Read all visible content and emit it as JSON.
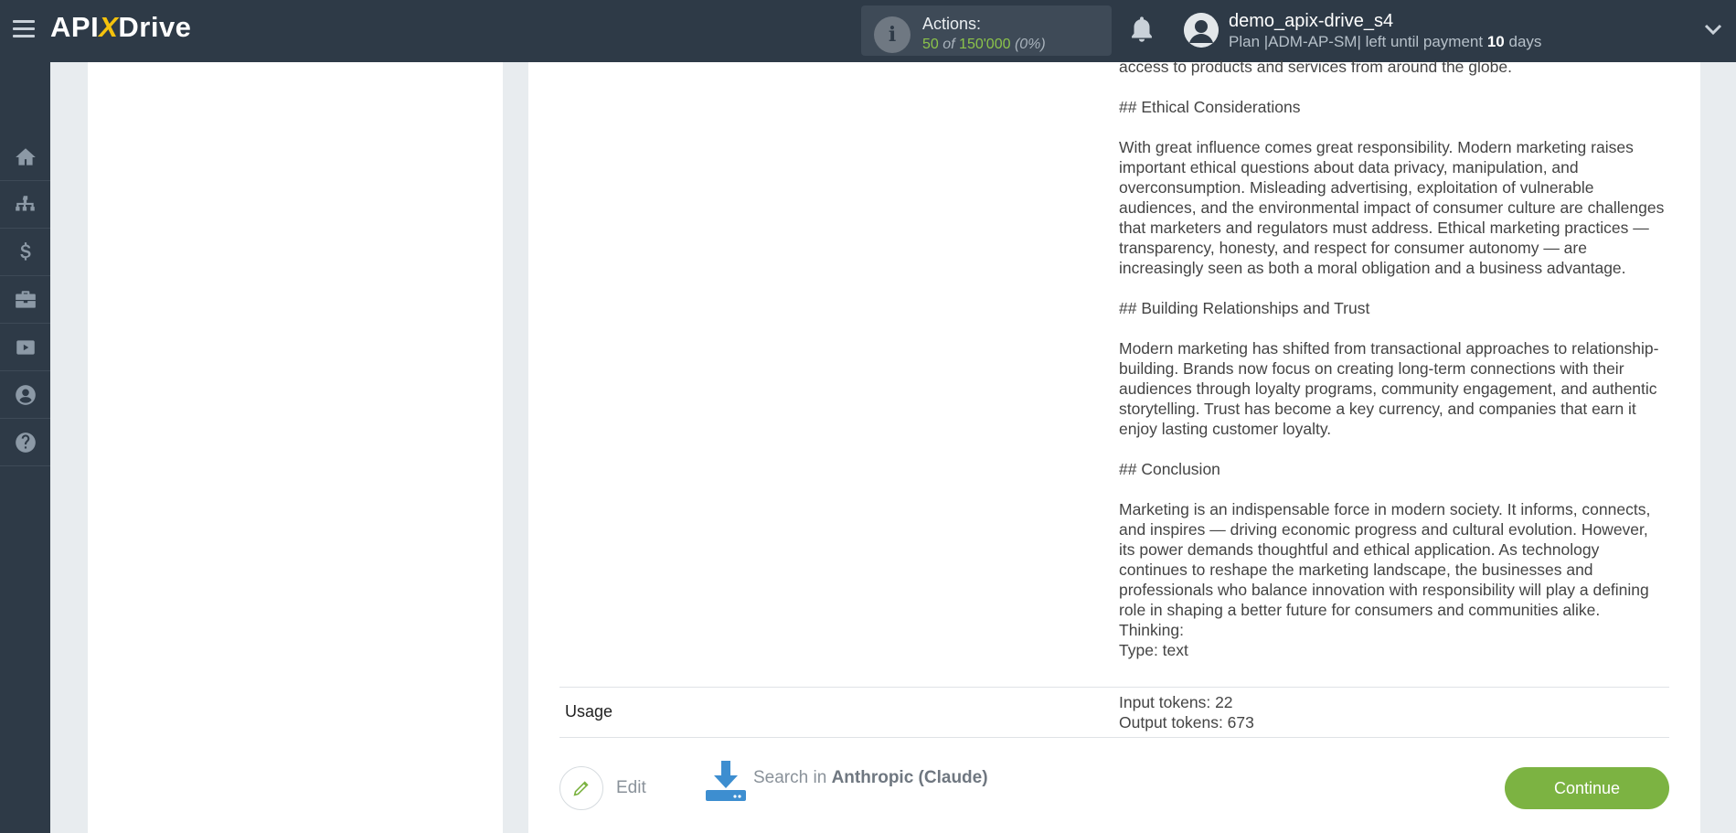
{
  "header": {
    "logo_left": "API",
    "logo_x": "X",
    "logo_right": "Drive",
    "actions_label": "Actions:",
    "actions_used": "50",
    "actions_of": "of",
    "actions_total": "150'000",
    "actions_percent": "(0%)",
    "username": "demo_apix-drive_s4",
    "plan_prefix": "Plan |ADM-AP-SM| left until payment",
    "plan_days": "10",
    "plan_suffix": "days"
  },
  "sidebar": {
    "items": [
      "home-icon",
      "sitemap-icon",
      "dollar-icon",
      "briefcase-icon",
      "youtube-icon",
      "user-circle-icon",
      "question-circle-icon"
    ]
  },
  "result": {
    "response_text": "access to products and services from around the globe.\n\n## Ethical Considerations\n\nWith great influence comes great responsibility. Modern marketing raises important ethical questions about data privacy, manipulation, and overconsumption. Misleading advertising, exploitation of vulnerable audiences, and the environmental impact of consumer culture are challenges that marketers and regulators must address. Ethical marketing practices — transparency, honesty, and respect for consumer autonomy — are increasingly seen as both a moral obligation and a business advantage.\n\n## Building Relationships and Trust\n\nModern marketing has shifted from transactional approaches to relationship-building. Brands now focus on creating long-term connections with their audiences through loyalty programs, community engagement, and authentic storytelling. Trust has become a key currency, and companies that earn it enjoy lasting customer loyalty.\n\n## Conclusion\n\nMarketing is an indispensable force in modern society. It informs, connects, and inspires — driving economic progress and cultural evolution. However, its power demands thoughtful and ethical application. As technology continues to reshape the marketing landscape, the businesses and professionals who balance innovation with responsibility will play a defining role in shaping a better future for consumers and communities alike.\nThinking:\nType: text",
    "usage_label": "Usage",
    "usage_value": "Input tokens: 22\nOutput tokens: 673"
  },
  "footer": {
    "edit_label": "Edit",
    "search_prefix": "Search in",
    "search_service": "Anthropic (Claude)",
    "continue_label": "Continue"
  },
  "colors": {
    "topbar": "#2e3a47",
    "accent_green": "#7cb342",
    "logo_yellow": "#f4c20d"
  }
}
